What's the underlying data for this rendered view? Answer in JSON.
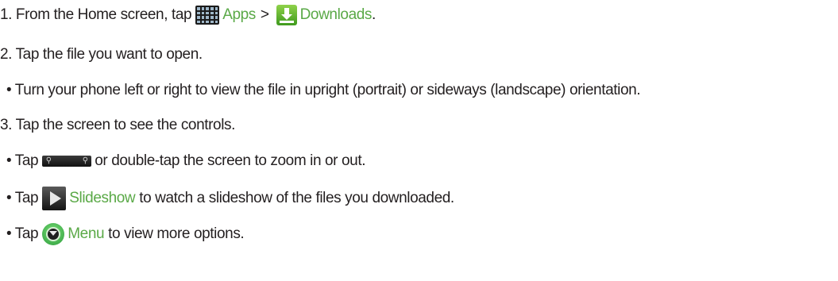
{
  "steps": {
    "s1": {
      "prefix": "1. From the Home screen, tap",
      "apps_label": "Apps",
      "separator": ">",
      "downloads_label": "Downloads",
      "suffix": "."
    },
    "s2": {
      "text": "2. Tap the file you want to open."
    },
    "s2_bullet": {
      "text": "• Turn your phone left or right to view the file in upright (portrait) or sideways (landscape) orientation."
    },
    "s3": {
      "text": "3. Tap the screen to see the controls."
    },
    "s3_b1": {
      "prefix": "• Tap",
      "suffix": "or double-tap the screen to zoom in or out."
    },
    "s3_b2": {
      "prefix": "• Tap",
      "link": "Slideshow",
      "suffix": "to watch a slideshow of the files you downloaded."
    },
    "s3_b3": {
      "prefix": "• Tap",
      "link": "Menu",
      "suffix": "to view more options."
    }
  },
  "icons": {
    "apps": "apps-grid-icon",
    "downloads": "download-arrow-icon",
    "zoom": "zoom-control-icon",
    "slideshow": "play-icon",
    "menu": "menu-icon"
  },
  "colors": {
    "text": "#231f20",
    "link": "#5aa947"
  }
}
